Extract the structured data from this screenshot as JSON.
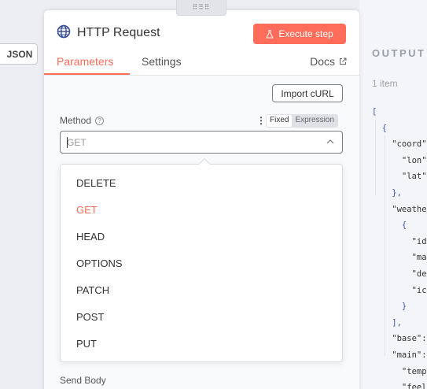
{
  "left_panel": {
    "json_button": "JSON"
  },
  "node": {
    "title": "HTTP Request",
    "execute_label": "Execute step",
    "tabs": {
      "parameters": "Parameters",
      "settings": "Settings",
      "docs": "Docs"
    },
    "import_curl": "Import cURL",
    "method": {
      "label": "Method",
      "mode_fixed": "Fixed",
      "mode_expression": "Expression",
      "value": "GET",
      "options": [
        "DELETE",
        "GET",
        "HEAD",
        "OPTIONS",
        "PATCH",
        "POST",
        "PUT"
      ],
      "selected_index": 1
    },
    "send_body_label": "Send Body"
  },
  "output": {
    "title": "OUTPUT",
    "item_count": "1 item",
    "json_lines": [
      "[",
      "  {",
      "    \"coord\"",
      "      \"lon\"",
      "      \"lat\"",
      "    },",
      "    \"weathe",
      "      {",
      "        \"id\"",
      "        \"mai",
      "        \"des",
      "        \"ico",
      "      }",
      "    ],",
      "    \"base\":",
      "    \"main\":",
      "      \"temp",
      "      \"feel"
    ]
  },
  "colors": {
    "accent": "#ff6d5a",
    "globe": "#3a4f9c"
  }
}
